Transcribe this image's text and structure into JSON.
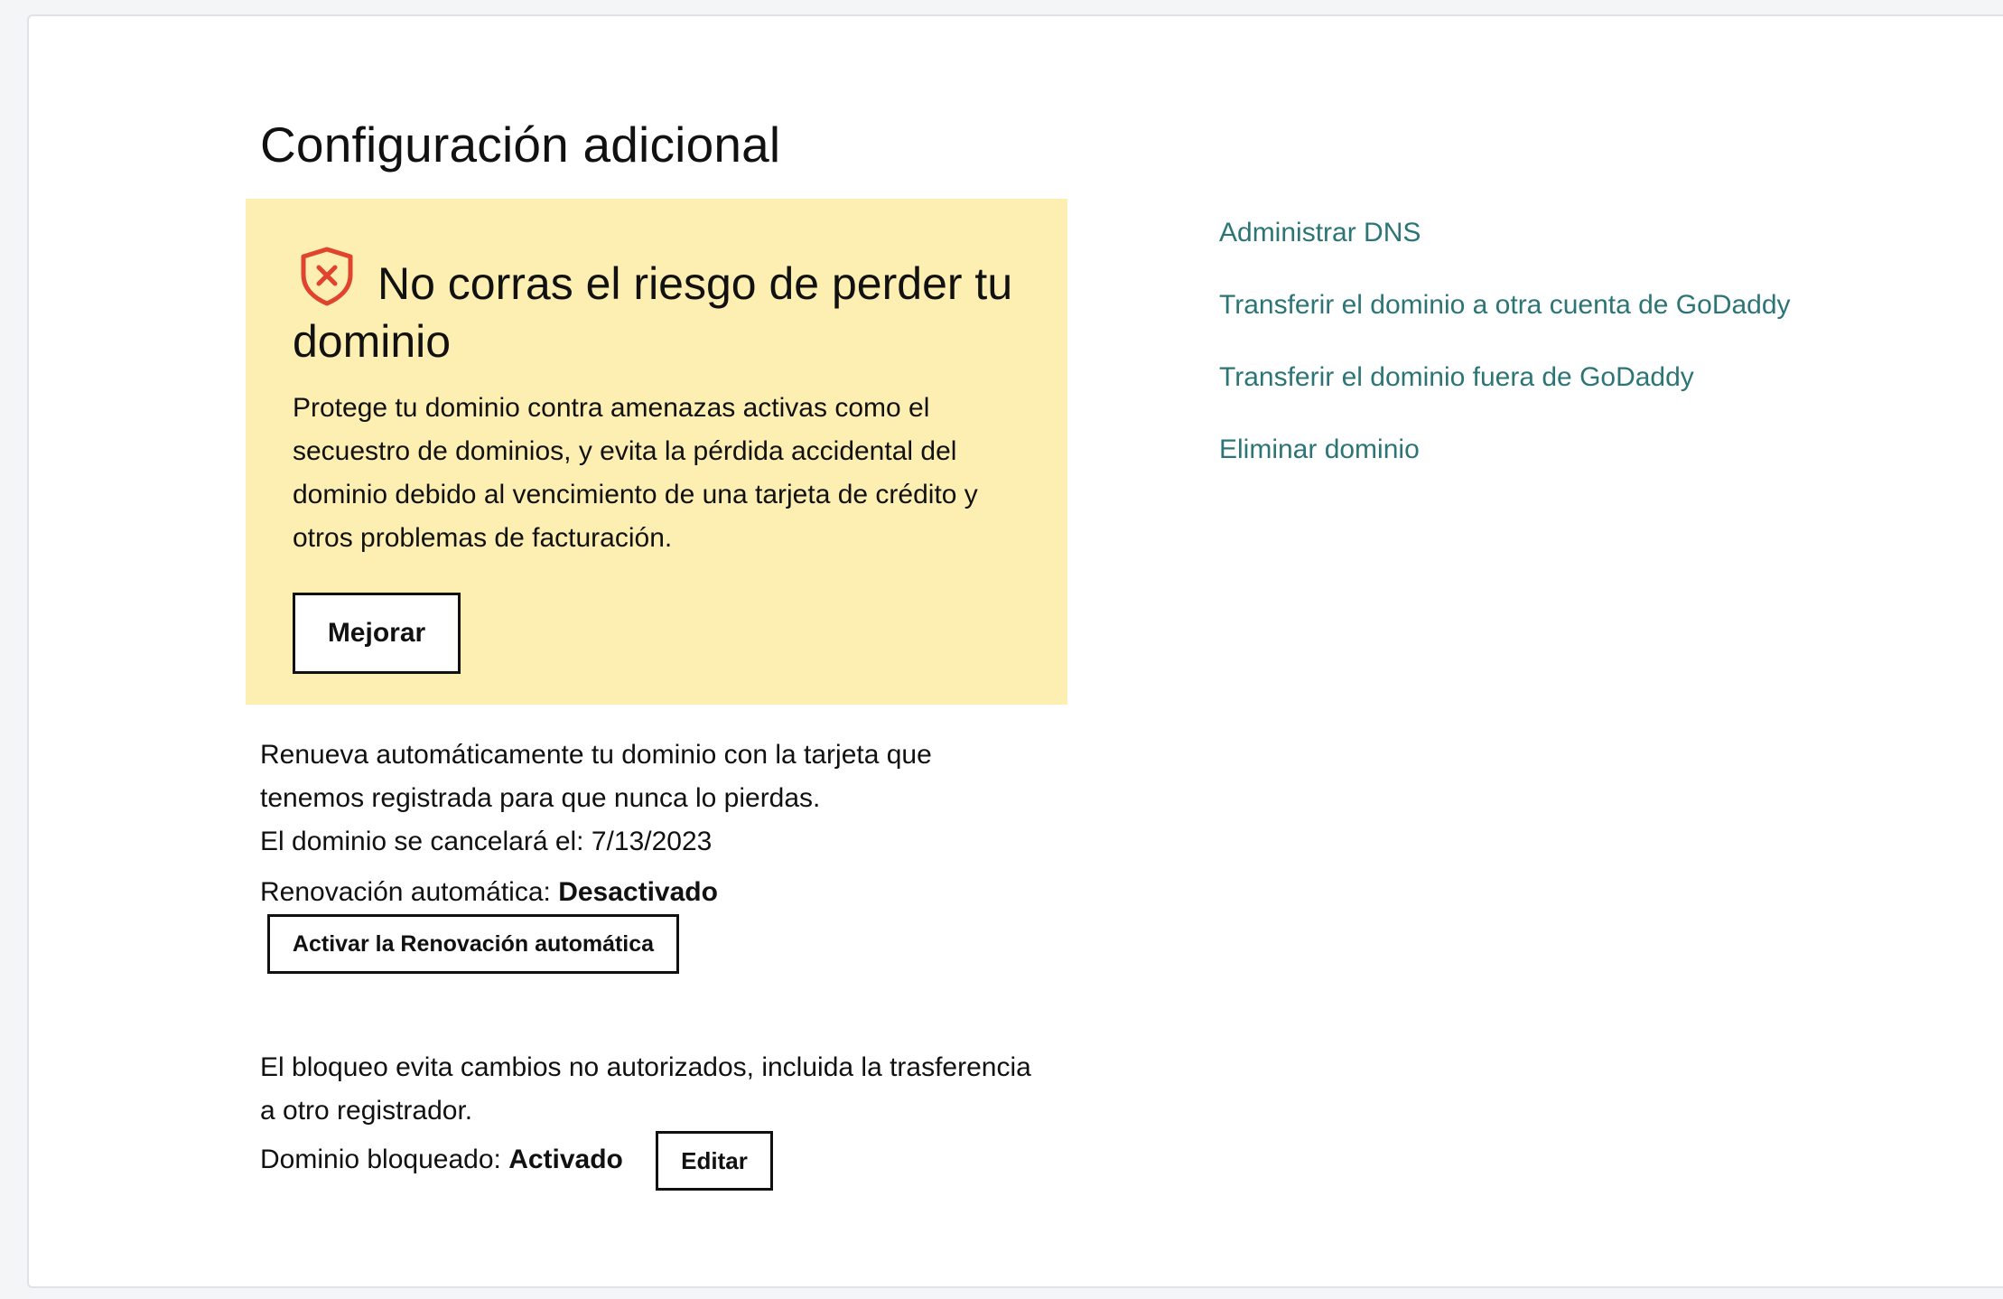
{
  "page": {
    "title": "Configuración adicional"
  },
  "promo": {
    "title": "No corras el riesgo de perder tu dominio",
    "body": "Protege tu dominio contra amenazas activas como el secuestro de dominios, y evita la pérdida accidental del dominio debido al vencimiento de una tarjeta de crédito y otros problemas de facturación.",
    "button_label": "Mejorar",
    "icon": "shield-x-icon",
    "background_color": "#fdeeb1",
    "icon_color": "#e0442f"
  },
  "auto_renew": {
    "description": "Renueva automáticamente tu dominio con la tarjeta que tenemos registrada para que nunca lo pierdas.",
    "cancel_label": "El dominio se cancelará el: ",
    "cancel_date": "7/13/2023",
    "status_label": "Renovación automática: ",
    "status_value": "Desactivado",
    "button_label": "Activar la Renovación automática"
  },
  "domain_lock": {
    "description": "El bloqueo evita cambios no autorizados, incluida la trasferencia a otro registrador.",
    "status_label": "Dominio bloqueado: ",
    "status_value": "Activado",
    "button_label": "Editar"
  },
  "links": [
    {
      "label": "Administrar DNS"
    },
    {
      "label": "Transferir el dominio a otra cuenta de GoDaddy"
    },
    {
      "label": "Transferir el dominio fuera de GoDaddy"
    },
    {
      "label": "Eliminar dominio"
    }
  ],
  "colors": {
    "link": "#2c7576",
    "text": "#111111"
  }
}
